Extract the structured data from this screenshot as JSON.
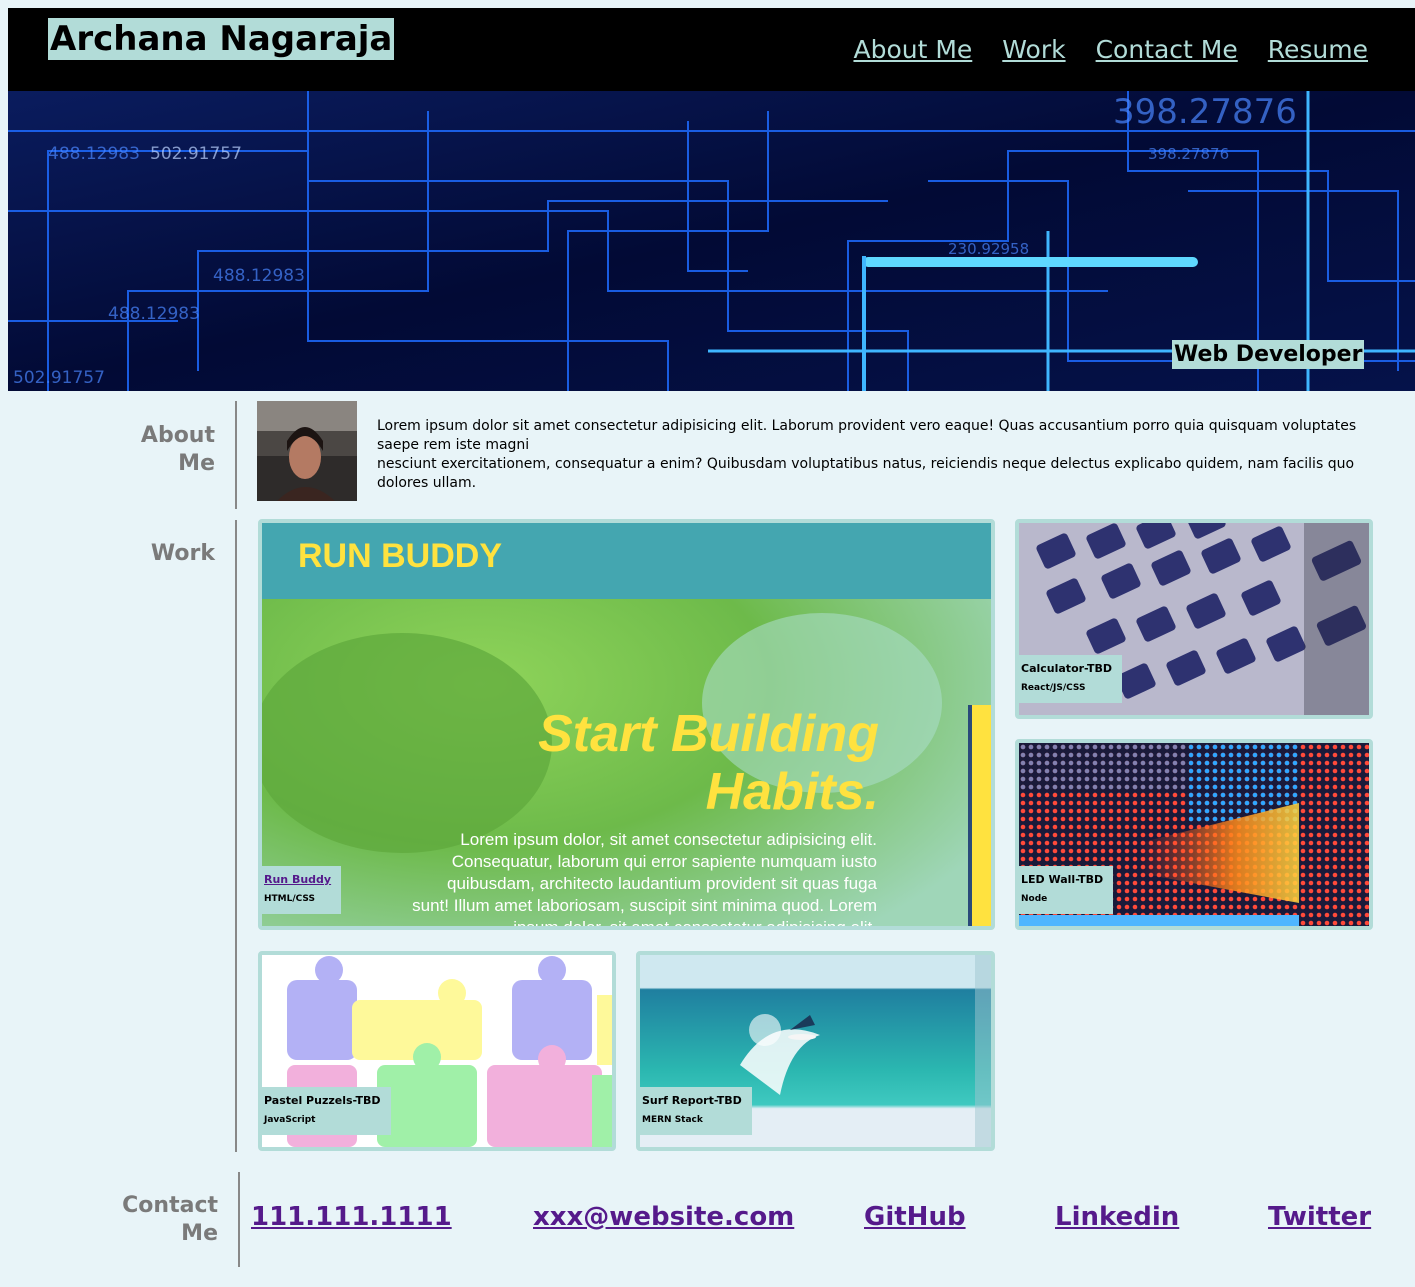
{
  "header": {
    "site_title": "Archana Nagaraja",
    "nav": [
      "About Me",
      "Work",
      "Contact Me",
      "Resume"
    ]
  },
  "hero": {
    "tagline": "Web Developer",
    "bg_numbers": [
      "488.12983",
      "502.91757",
      "488.12983",
      "488.12983",
      "502.91757",
      "398.27876",
      "230.92958",
      "398.27876"
    ]
  },
  "about": {
    "label": "About Me",
    "text_line1": "Lorem ipsum dolor sit amet consectetur adipisicing elit. Laborum provident vero eaque! Quas accusantium porro quia quisquam voluptates saepe rem iste magni",
    "text_line2": "nesciunt exercitationem, consequatur a enim? Quibusdam voluptatibus natus, reiciendis neque delectus explicabo quidem, nam facilis quo dolores ullam."
  },
  "work": {
    "label": "Work",
    "featured": {
      "name": "Run Buddy",
      "tech": "HTML/CSS",
      "screenshot_title": "RUN BUDDY",
      "screenshot_heading_1": "Start Building",
      "screenshot_heading_2": "Habits.",
      "screenshot_body": "Lorem ipsum dolor, sit amet consectetur adipisicing elit. Consequatur, laborum qui error sapiente numquam iusto quibusdam, architecto laudantium provident sit quas fuga sunt! Illum amet laboriosam, suscipit sint minima quod. Lorem ipsum dolor, sit amet consectetur adipisicing elit."
    },
    "projects": [
      {
        "name": "Calculator-TBD",
        "tech": "React/JS/CSS"
      },
      {
        "name": "LED Wall-TBD",
        "tech": "Node"
      },
      {
        "name": "Pastel Puzzels-TBD",
        "tech": "JavaScript"
      },
      {
        "name": "Surf Report-TBD",
        "tech": "MERN Stack"
      }
    ]
  },
  "contact": {
    "label": "Contact Me",
    "phone": "111.111.1111",
    "email": "xxx@website.com",
    "github": "GitHub",
    "linkedin": "Linkedin",
    "twitter": "Twitter"
  },
  "colors": {
    "page_bg": "#e8f4f8",
    "accent": "#b2dcd8",
    "link": "#551a8b",
    "header_bg": "#000000"
  }
}
